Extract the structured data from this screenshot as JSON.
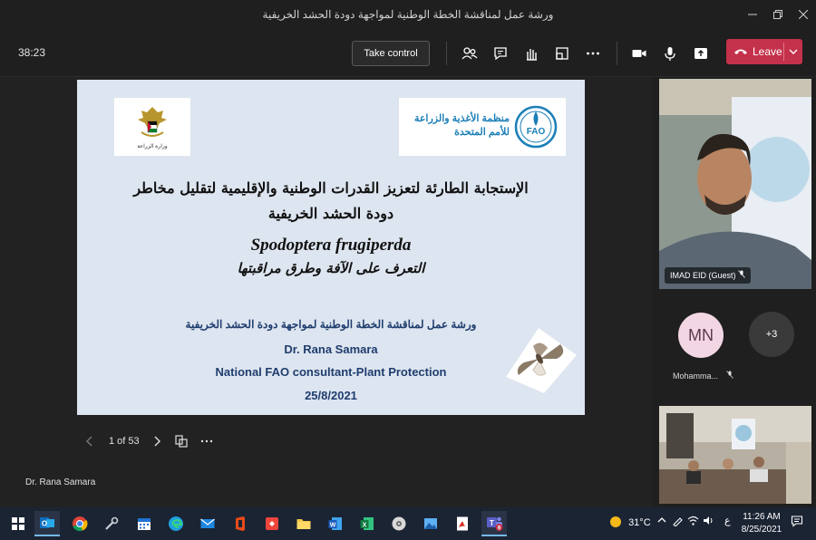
{
  "window": {
    "title": "ورشة عمل لمناقشة الخطة الوطنية لمواجهة دودة الحشد الخريفية"
  },
  "toolbar": {
    "timer": "38:23",
    "take_control_label": "Take control",
    "leave_label": "Leave",
    "leave_color": "#c4314b"
  },
  "slide": {
    "left_logo_caption": "وزارة الزراعة",
    "fao_name_line1": "منظمة الأغذية والزراعة",
    "fao_name_line2": "للأمم المتحدة",
    "fao_abbrev": "FAO",
    "title_line1": "الإستجابة الطارئة لتعزيز القدرات الوطنية والإقليمية لتقليل مخاطر",
    "title_line2": "دودة الحشد الخريفية",
    "species": "Spodoptera frugiperda",
    "subtitle": "التعرف على الآفة وطرق مراقبتها",
    "workshop": "ورشة عمل لمناقشة الخطة الوطنية لمواجهة دودة الحشد الخريفية",
    "presenter": "Dr. Rana Samara",
    "role": "National FAO consultant-Plant Protection",
    "date": "25/8/2021",
    "text_color": "#1f3d6e"
  },
  "slide_nav": {
    "page_indicator": "1 of 53"
  },
  "presenter_label": "Dr. Rana Samara",
  "participants": {
    "video1_name": "IMAD EID (Guest)",
    "avatar_initials": "MN",
    "avatar_name": "Mohamma...",
    "overflow_count": "+3"
  },
  "taskbar": {
    "weather": "31°C",
    "language": "ع",
    "time": "11:26 AM",
    "date": "8/25/2021",
    "teams_badge": "9"
  }
}
